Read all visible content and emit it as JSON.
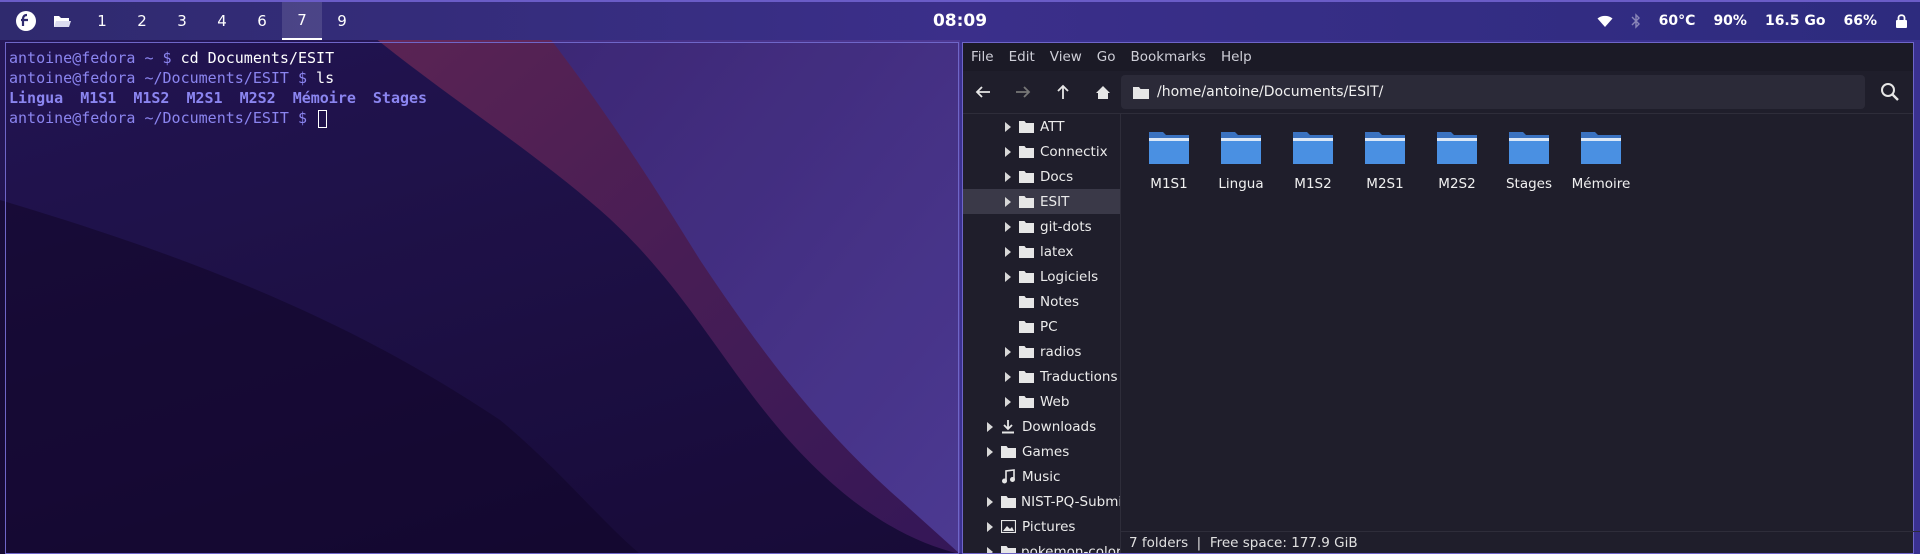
{
  "topbar": {
    "workspaces": [
      "1",
      "2",
      "3",
      "4",
      "6",
      "7",
      "9"
    ],
    "active_workspace": "7",
    "clock": "08:09",
    "status": {
      "temperature": "60°C",
      "cpu_percent": "90%",
      "memory": "16.5 Go",
      "battery": "66%"
    },
    "icons": [
      "fedora-logo-icon",
      "folder-open-icon",
      "wifi-icon",
      "bluetooth-icon",
      "lock-icon"
    ]
  },
  "terminal": {
    "lines": [
      {
        "prompt": "antoine@fedora ~ $",
        "command": " cd Documents/ESIT"
      },
      {
        "prompt": "antoine@fedora ~/Documents/ESIT $",
        "command": " ls"
      }
    ],
    "ls_output": [
      "Lingua",
      "M1S1",
      "M1S2",
      "M2S1",
      "M2S2",
      "Mémoire",
      "Stages"
    ],
    "current_prompt": "antoine@fedora ~/Documents/ESIT $"
  },
  "file_manager": {
    "menu": [
      "File",
      "Edit",
      "View",
      "Go",
      "Bookmarks",
      "Help"
    ],
    "path": "/home/antoine/Documents/ESIT/",
    "sidebar": [
      {
        "label": "ATT",
        "expandable": true,
        "icon": "folder",
        "level": 2
      },
      {
        "label": "Connectix",
        "expandable": true,
        "icon": "folder",
        "level": 2
      },
      {
        "label": "Docs",
        "expandable": true,
        "icon": "folder",
        "level": 2
      },
      {
        "label": "ESIT",
        "expandable": true,
        "icon": "folder",
        "level": 2,
        "selected": true
      },
      {
        "label": "git-dots",
        "expandable": true,
        "icon": "folder",
        "level": 2
      },
      {
        "label": "latex",
        "expandable": true,
        "icon": "folder",
        "level": 2
      },
      {
        "label": "Logiciels",
        "expandable": true,
        "icon": "folder",
        "level": 2
      },
      {
        "label": "Notes",
        "expandable": false,
        "icon": "folder",
        "level": 2
      },
      {
        "label": "PC",
        "expandable": false,
        "icon": "folder",
        "level": 2
      },
      {
        "label": "radios",
        "expandable": true,
        "icon": "folder",
        "level": 2
      },
      {
        "label": "Traductions",
        "expandable": true,
        "icon": "folder",
        "level": 2
      },
      {
        "label": "Web",
        "expandable": true,
        "icon": "folder",
        "level": 2
      },
      {
        "label": "Downloads",
        "expandable": true,
        "icon": "download",
        "level": 1
      },
      {
        "label": "Games",
        "expandable": true,
        "icon": "folder",
        "level": 1
      },
      {
        "label": "Music",
        "expandable": false,
        "icon": "music",
        "level": 1
      },
      {
        "label": "NIST-PQ-Submis",
        "expandable": true,
        "icon": "folder",
        "level": 1
      },
      {
        "label": "Pictures",
        "expandable": true,
        "icon": "picture",
        "level": 1
      },
      {
        "label": "pokemon-colors",
        "expandable": true,
        "icon": "folder",
        "level": 1
      }
    ],
    "folders": [
      "M1S1",
      "Lingua",
      "M1S2",
      "M2S1",
      "M2S2",
      "Stages",
      "Mémoire"
    ],
    "status": "7 folders  |  Free space: 177.9 GiB",
    "colors": {
      "folder_blue": "#4a90e2",
      "accent": "#6f66c8"
    }
  }
}
